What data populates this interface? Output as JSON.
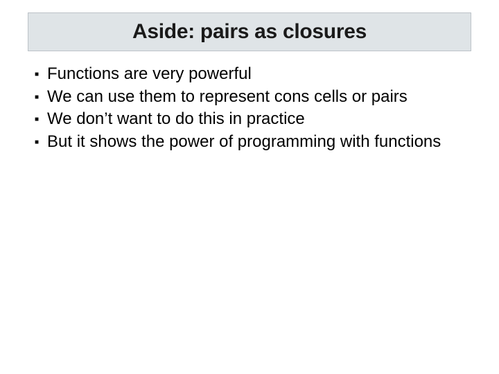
{
  "title": "Aside: pairs as closures",
  "bullets": [
    "Functions are very powerful",
    "We can use them to represent cons cells or pairs",
    "We don’t want to do this in practice",
    "But it shows the power of programming with functions"
  ]
}
